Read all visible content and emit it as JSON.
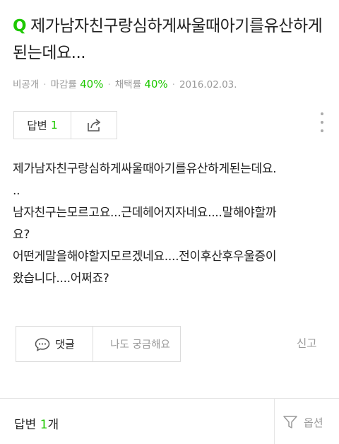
{
  "question": {
    "mark": "Q",
    "title": "제가남자친구랑심하게싸울때아기를유산하게된는데요..."
  },
  "meta": {
    "privacy": "비공개",
    "close_rate_label": "마감률",
    "close_rate_value": "40%",
    "select_rate_label": "채택률",
    "select_rate_value": "40%",
    "date": "2016.02.03."
  },
  "answer_box": {
    "label": "답변",
    "count": "1"
  },
  "body": {
    "lines": [
      "제가남자친구랑심하게싸울때아기를유산하게된는데요.",
      "..",
      "남자친구는모르고요...근데헤어지자네요....말해야할까",
      "요?",
      "어떤게말을해야할지모르겠네요....전이후산후우울증이",
      "왔습니다....어쩌죠?"
    ]
  },
  "actions": {
    "comment_label": "댓글",
    "curious_label": "나도 궁금해요",
    "report_label": "신고"
  },
  "bottom": {
    "answers_label": "답변",
    "answers_count": "1",
    "answers_unit": "개",
    "options_label": "옵션"
  },
  "colors": {
    "accent": "#1ec800",
    "muted": "#999999",
    "border": "#dcdcdc"
  }
}
